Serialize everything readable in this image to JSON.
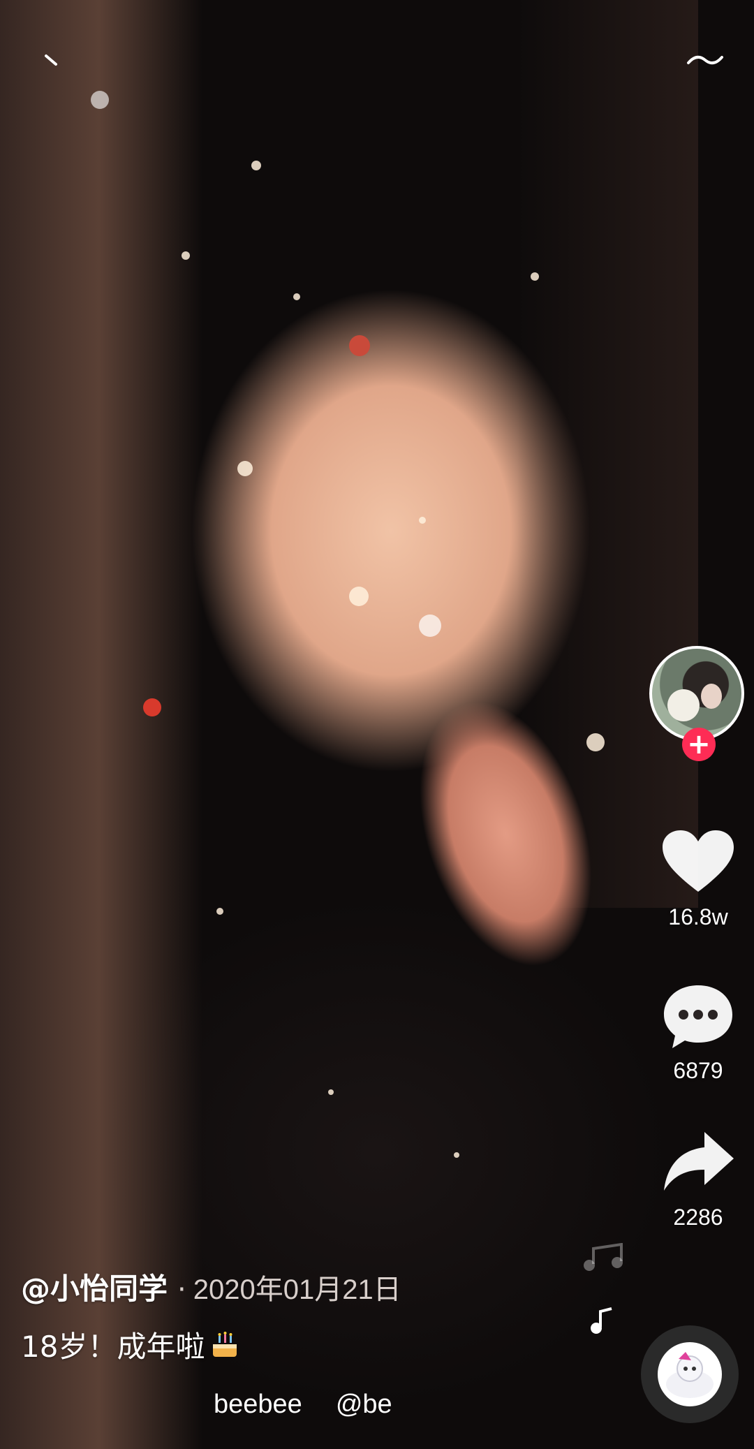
{
  "video": {
    "author": "@小怡同学",
    "separator": "·",
    "date": "2020年01月21日",
    "caption": "18岁！成年啦",
    "caption_emoji": "cake-icon",
    "music": {
      "title": "beebee",
      "author": "@be"
    }
  },
  "actions": {
    "likes": "16.8w",
    "comments": "6879",
    "shares": "2286"
  },
  "colors": {
    "follow_button": "#fe2c55",
    "icon": "#ffffff"
  }
}
